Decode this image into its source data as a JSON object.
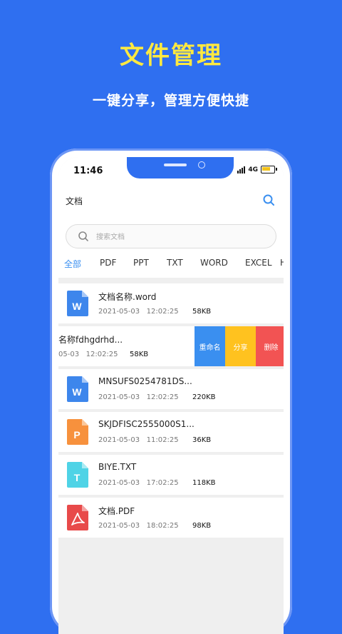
{
  "hero": {
    "title": "文件管理",
    "subtitle": "一键分享，管理方便快捷"
  },
  "status": {
    "time": "11:46",
    "network": "4G"
  },
  "header": {
    "title": "文档"
  },
  "search": {
    "placeholder": "搜索文档"
  },
  "tabs": [
    "全部",
    "PDF",
    "PPT",
    "TXT",
    "WORD",
    "EXCEL",
    "H"
  ],
  "files": [
    {
      "type": "word",
      "letter": "W",
      "name": "文档名称.word",
      "date": "2021-05-03",
      "time": "12:02:25",
      "size": "58KB"
    },
    {
      "type": "word",
      "letter": "",
      "name": "名称fdhgdrhd...",
      "date": "05-03",
      "time": "12:02:25",
      "size": "58KB"
    },
    {
      "type": "word",
      "letter": "W",
      "name": "MNSUFS0254781DS...",
      "date": "2021-05-03",
      "time": "12:02:25",
      "size": "220KB"
    },
    {
      "type": "ppt",
      "letter": "P",
      "name": "SKJDFISC2555000S1...",
      "date": "2021-05-03",
      "time": "11:02:25",
      "size": "36KB"
    },
    {
      "type": "txt",
      "letter": "T",
      "name": "BIYE.TXT",
      "date": "2021-05-03",
      "time": "17:02:25",
      "size": "118KB"
    },
    {
      "type": "pdf",
      "letter": "",
      "name": "文档.PDF",
      "date": "2021-05-03",
      "time": "18:02:25",
      "size": "98KB"
    }
  ],
  "actions": {
    "rename": "重命名",
    "share": "分享",
    "delete": "删除"
  },
  "colors": {
    "background": "#2f6ff0",
    "title": "#ffe940",
    "active_tab": "#3a8ff0",
    "word": "#3d86ec",
    "ppt": "#f7913d",
    "txt": "#4fd3e6",
    "pdf": "#e84a4a",
    "rename": "#3a8ff0",
    "share": "#ffc21f",
    "delete": "#f25353"
  }
}
